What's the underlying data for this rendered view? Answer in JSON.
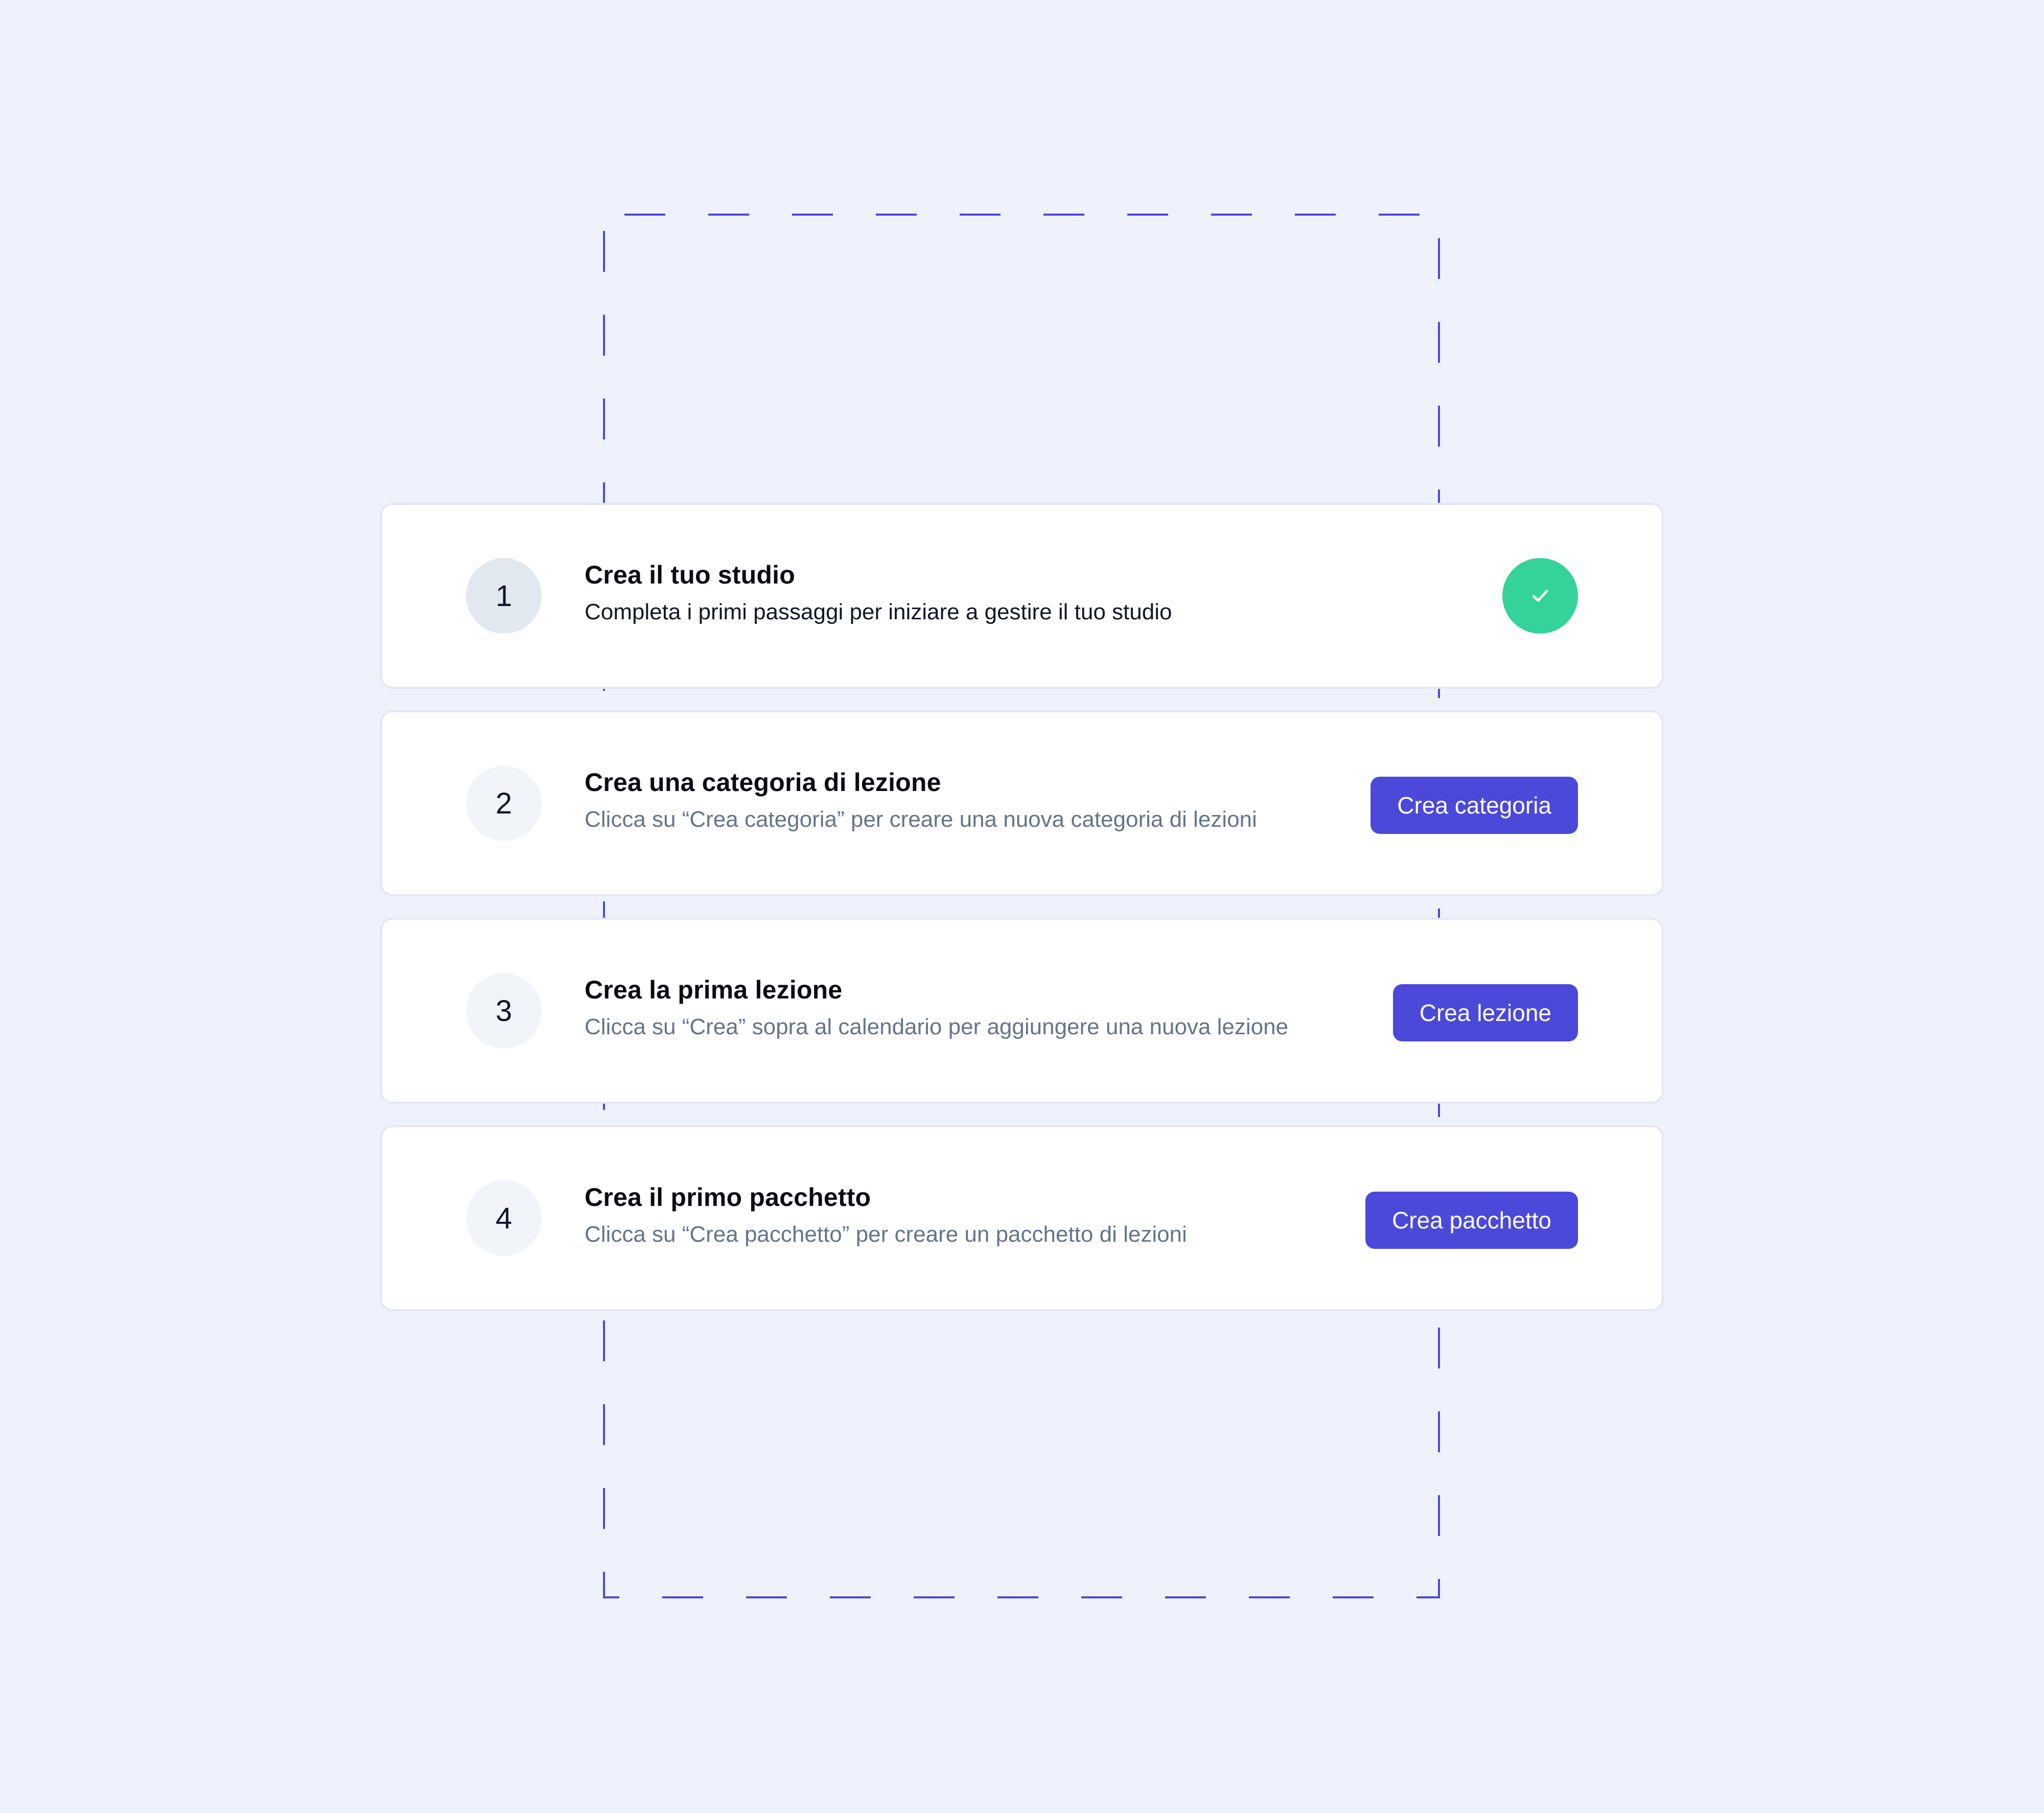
{
  "colors": {
    "background": "#EEF2FC",
    "accent": "#4B49DA",
    "success": "#34D399",
    "dashed_frame": "#4B49DA"
  },
  "steps": [
    {
      "number": "1",
      "title": "Crea il tuo studio",
      "description": "Completa i primi passaggi per iniziare a gestire il tuo studio",
      "status": "completed",
      "status_icon": "check-icon"
    },
    {
      "number": "2",
      "title": "Crea una categoria di lezione",
      "description": "Clicca su “Crea categoria” per creare una nuova categoria di lezioni",
      "action_label": "Crea categoria"
    },
    {
      "number": "3",
      "title": "Crea la prima lezione",
      "description": "Clicca su “Crea” sopra al calendario per aggiungere una nuova lezione",
      "action_label": "Crea lezione"
    },
    {
      "number": "4",
      "title": "Crea il primo pacchetto",
      "description": "Clicca su “Crea pacchetto” per creare un pacchetto di lezioni",
      "action_label": "Crea pacchetto"
    }
  ]
}
